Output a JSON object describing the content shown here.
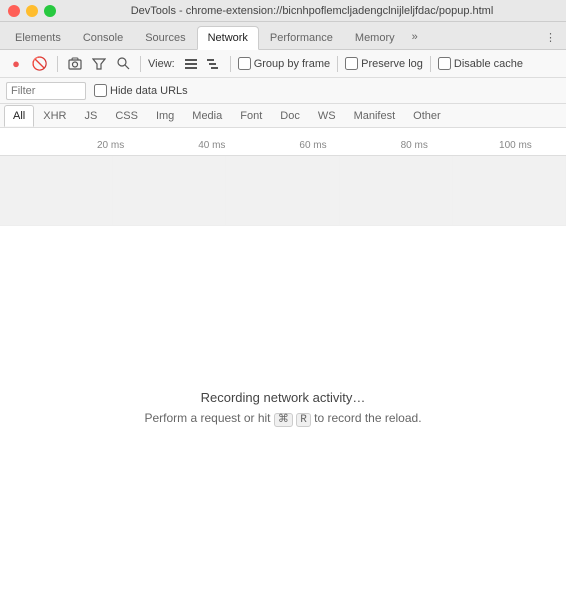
{
  "titleBar": {
    "title": "DevTools - chrome-extension://bicnhpoflemcljadengclnijleljfdac/popup.html"
  },
  "tabs": [
    {
      "id": "elements",
      "label": "Elements",
      "active": false
    },
    {
      "id": "console",
      "label": "Console",
      "active": false
    },
    {
      "id": "sources",
      "label": "Sources",
      "active": false
    },
    {
      "id": "network",
      "label": "Network",
      "active": true
    },
    {
      "id": "performance",
      "label": "Performance",
      "active": false
    },
    {
      "id": "memory",
      "label": "Memory",
      "active": false
    }
  ],
  "toolbar": {
    "record_btn": "⏺",
    "stop_btn": "⛔",
    "view_label": "View:",
    "group_by_frame": "Group by frame",
    "preserve_log": "Preserve log",
    "disable_cache": "Disable cache"
  },
  "filterBar": {
    "filter_placeholder": "Filter",
    "hide_data_urls": "Hide data URLs"
  },
  "typeTabs": [
    {
      "id": "all",
      "label": "All",
      "active": true
    },
    {
      "id": "xhr",
      "label": "XHR",
      "active": false
    },
    {
      "id": "js",
      "label": "JS",
      "active": false
    },
    {
      "id": "css",
      "label": "CSS",
      "active": false
    },
    {
      "id": "img",
      "label": "Img",
      "active": false
    },
    {
      "id": "media",
      "label": "Media",
      "active": false
    },
    {
      "id": "font",
      "label": "Font",
      "active": false
    },
    {
      "id": "doc",
      "label": "Doc",
      "active": false
    },
    {
      "id": "ws",
      "label": "WS",
      "active": false
    },
    {
      "id": "manifest",
      "label": "Manifest",
      "active": false
    },
    {
      "id": "other",
      "label": "Other",
      "active": false
    }
  ],
  "timeline": {
    "ticks": [
      "20 ms",
      "40 ms",
      "60 ms",
      "80 ms",
      "100 ms"
    ]
  },
  "content": {
    "message1": "Recording network activity…",
    "message2_prefix": "Perform a request or hit ",
    "message2_key": "⌘",
    "message2_key2": "R",
    "message2_suffix": " to record the reload."
  }
}
